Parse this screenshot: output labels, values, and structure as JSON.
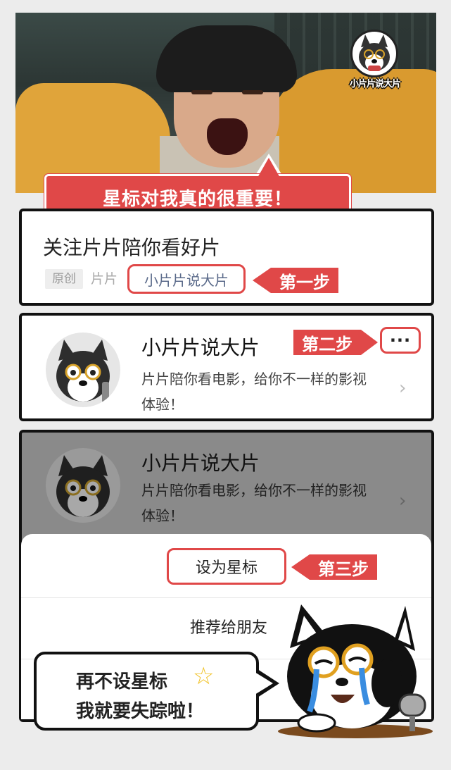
{
  "hero": {
    "logo_text": "小片片说大片"
  },
  "banner": {
    "text": "星标对我真的很重要！"
  },
  "article": {
    "title": "关注片片陪你看好片",
    "tag_original": "原创",
    "tag_author": "片片",
    "account_link": "小片片说大片"
  },
  "steps": {
    "step1": "第一步",
    "step2": "第二步",
    "step3": "第三步"
  },
  "account_card": {
    "name": "小片片说大片",
    "desc_line1": "片片陪你看电影，给你不一样的影视",
    "desc_line2": "体验！",
    "more_label": "···",
    "chevron": "›"
  },
  "sheet": {
    "set_star": "设为星标",
    "recommend": "推荐给朋友"
  },
  "bubble": {
    "line1": "再不设星标",
    "star": "☆",
    "line2": "我就要失踪啦！"
  },
  "colors": {
    "accent": "#e04848",
    "border": "#111111",
    "overlay": "#8a8a8a"
  }
}
